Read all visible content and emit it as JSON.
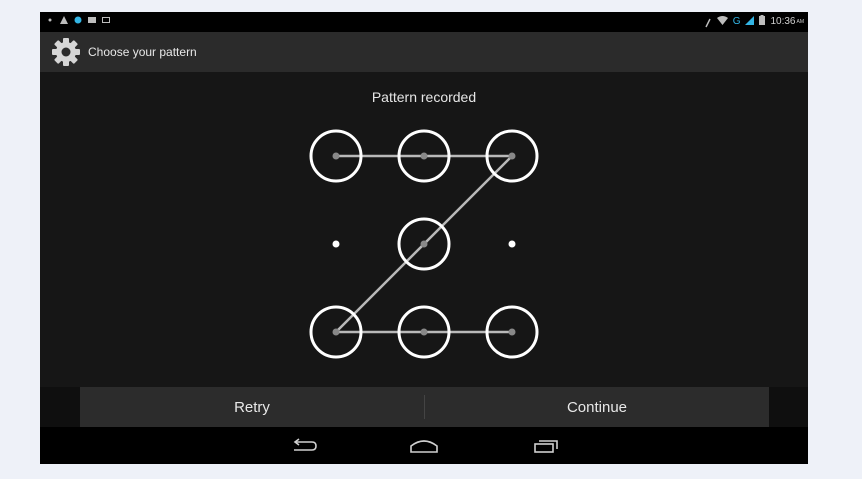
{
  "status_bar": {
    "time": "10:36",
    "ampm": "AM",
    "left_icons": [
      "notification-dot-icon",
      "warning-icon",
      "android-icon",
      "message-icon",
      "screenshot-icon"
    ],
    "right_icons": [
      "location-icon",
      "wifi-icon",
      "network-G-icon",
      "signal-icon",
      "battery-icon"
    ],
    "network_label": "G"
  },
  "action_bar": {
    "title": "Choose your pattern",
    "icon": "settings-gear-icon"
  },
  "pattern": {
    "header": "Pattern recorded",
    "selected_sequence": [
      1,
      2,
      3,
      5,
      7,
      8,
      9
    ],
    "colors": {
      "ring": "#ffffff",
      "line": "#b9b9b9",
      "dot": "#ffffff"
    }
  },
  "buttons": {
    "retry": "Retry",
    "continue": "Continue"
  },
  "nav_bar": {
    "icons": [
      "back-icon",
      "home-icon",
      "recent-apps-icon"
    ]
  }
}
